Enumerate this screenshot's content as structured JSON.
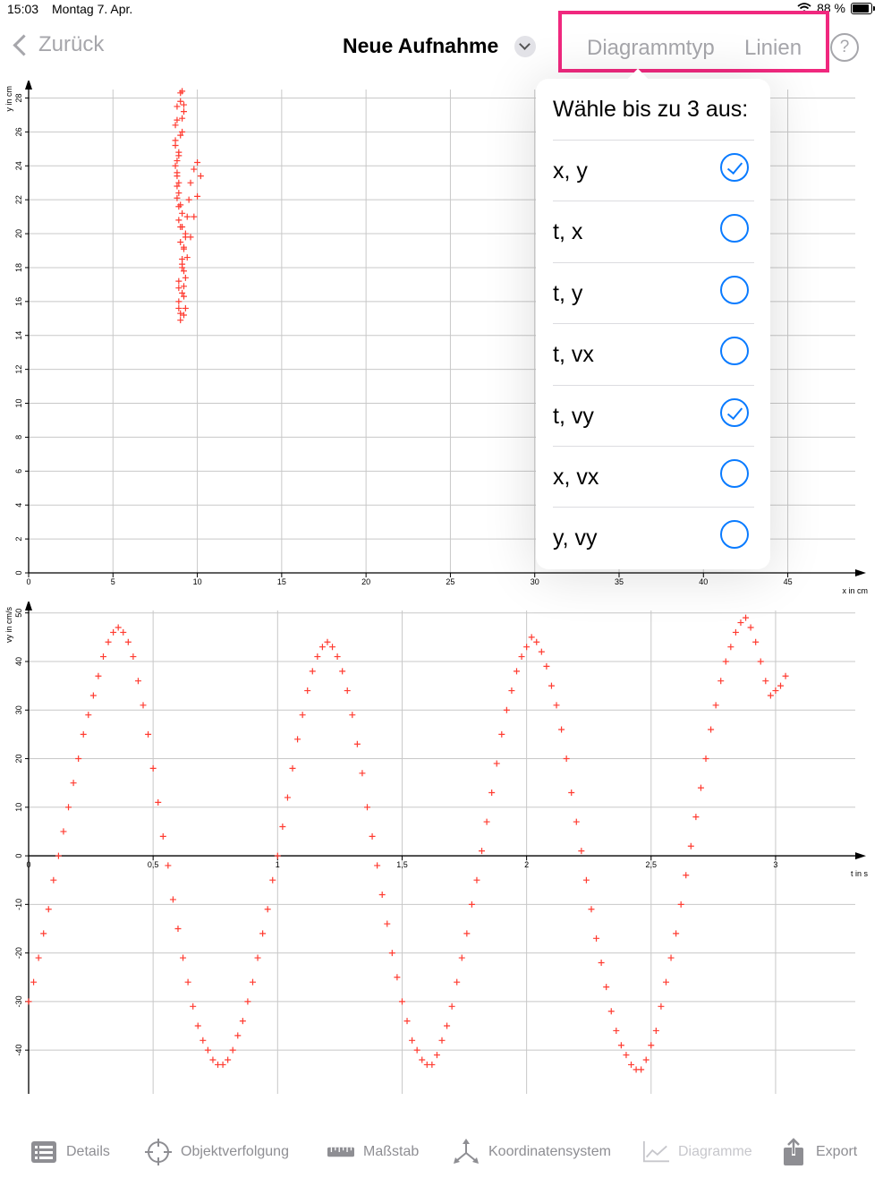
{
  "status": {
    "time": "15:03",
    "date": "Montag 7. Apr.",
    "battery": "88 %"
  },
  "nav": {
    "back": "Zurück",
    "title": "Neue Aufnahme",
    "btn_type": "Diagrammtyp",
    "btn_lines": "Linien",
    "help": "?"
  },
  "popover": {
    "heading": "Wähle bis zu 3 aus:",
    "items": [
      {
        "label": "x, y",
        "checked": true
      },
      {
        "label": "t, x",
        "checked": false
      },
      {
        "label": "t, y",
        "checked": false
      },
      {
        "label": "t, vx",
        "checked": false
      },
      {
        "label": "t, vy",
        "checked": true
      },
      {
        "label": "x, vx",
        "checked": false
      },
      {
        "label": "y, vy",
        "checked": false
      }
    ]
  },
  "chart_data": [
    {
      "type": "scatter",
      "xlabel": "x in cm",
      "ylabel": "y in cm",
      "xlim": [
        0,
        49
      ],
      "ylim": [
        0,
        28.5
      ],
      "xticks": [
        0,
        5,
        10,
        15,
        20,
        25,
        30,
        35,
        40,
        45
      ],
      "yticks": [
        0,
        2,
        4,
        6,
        8,
        10,
        12,
        14,
        16,
        18,
        20,
        22,
        24,
        26,
        28
      ],
      "grid": true,
      "marker": "+",
      "color": "#ff3b30",
      "series": [
        {
          "x": [
            9.0,
            8.9,
            8.9,
            9.1,
            9.3,
            9.4,
            9.5,
            9.6,
            9.8,
            10.0,
            10.2,
            10.0,
            9.8,
            9.6,
            9.4,
            9.3,
            9.2,
            9.2,
            9.3,
            9.2,
            9.1,
            9.0,
            8.9,
            8.8,
            8.8,
            8.9,
            9.0,
            9.1,
            9.2,
            9.0,
            8.8,
            8.7,
            8.7,
            8.7,
            8.8,
            8.9,
            9.0,
            9.2,
            9.1,
            8.9,
            8.9,
            9.0,
            9.1,
            9.2,
            9.2,
            9.1,
            9.0,
            8.9,
            8.8,
            8.7,
            8.8,
            9.0,
            9.1,
            9.2,
            9.1,
            8.9,
            8.8,
            8.9,
            9.1,
            9.3
          ],
          "y": [
            14.9,
            16.0,
            17.2,
            18.5,
            19.8,
            21.0,
            22.0,
            23.0,
            23.8,
            24.2,
            23.4,
            22.2,
            21.0,
            19.8,
            18.6,
            17.4,
            16.3,
            15.2,
            15.6,
            16.9,
            18.2,
            19.5,
            20.8,
            22.1,
            23.4,
            24.6,
            25.8,
            26.8,
            27.6,
            28.3,
            27.5,
            26.4,
            25.2,
            24.0,
            22.8,
            21.6,
            20.4,
            19.2,
            18.0,
            16.8,
            15.6,
            15.3,
            16.5,
            17.8,
            19.1,
            20.4,
            21.7,
            23.0,
            24.3,
            25.5,
            26.7,
            27.8,
            28.4,
            27.2,
            26.0,
            24.8,
            23.6,
            22.4,
            21.2,
            20.0
          ]
        }
      ]
    },
    {
      "type": "scatter",
      "xlabel": "t in s",
      "ylabel": "vy in cm/s",
      "xlim": [
        0,
        3.32
      ],
      "ylim": [
        -49,
        50.5
      ],
      "xticks": [
        0,
        0.5,
        1,
        1.5,
        2,
        2.5,
        3
      ],
      "xticklabels": [
        "0",
        "0,5",
        "1",
        "1,5",
        "2",
        "2,5",
        "3"
      ],
      "yticks": [
        -40,
        -30,
        -20,
        -10,
        0,
        10,
        20,
        30,
        40,
        50
      ],
      "grid": true,
      "marker": "+",
      "color": "#ff3b30",
      "series": [
        {
          "t": [
            0.0,
            0.02,
            0.04,
            0.06,
            0.08,
            0.1,
            0.12,
            0.14,
            0.16,
            0.18,
            0.2,
            0.22,
            0.24,
            0.26,
            0.28,
            0.3,
            0.32,
            0.34,
            0.36,
            0.38,
            0.4,
            0.42,
            0.44,
            0.46,
            0.48,
            0.5,
            0.52,
            0.54,
            0.56,
            0.58,
            0.6,
            0.62,
            0.64,
            0.66,
            0.68,
            0.7,
            0.72,
            0.74,
            0.76,
            0.78,
            0.8,
            0.82,
            0.84,
            0.86,
            0.88,
            0.9,
            0.92,
            0.94,
            0.96,
            0.98,
            1.0,
            1.02,
            1.04,
            1.06,
            1.08,
            1.1,
            1.12,
            1.14,
            1.16,
            1.18,
            1.2,
            1.22,
            1.24,
            1.26,
            1.28,
            1.3,
            1.32,
            1.34,
            1.36,
            1.38,
            1.4,
            1.42,
            1.44,
            1.46,
            1.48,
            1.5,
            1.52,
            1.54,
            1.56,
            1.58,
            1.6,
            1.62,
            1.64,
            1.66,
            1.68,
            1.7,
            1.72,
            1.74,
            1.76,
            1.78,
            1.8,
            1.82,
            1.84,
            1.86,
            1.88,
            1.9,
            1.92,
            1.94,
            1.96,
            1.98,
            2.0,
            2.02,
            2.04,
            2.06,
            2.08,
            2.1,
            2.12,
            2.14,
            2.16,
            2.18,
            2.2,
            2.22,
            2.24,
            2.26,
            2.28,
            2.3,
            2.32,
            2.34,
            2.36,
            2.38,
            2.4,
            2.42,
            2.44,
            2.46,
            2.48,
            2.5,
            2.52,
            2.54,
            2.56,
            2.58,
            2.6,
            2.62,
            2.64,
            2.66,
            2.68,
            2.7,
            2.72,
            2.74,
            2.76,
            2.78,
            2.8,
            2.82,
            2.84,
            2.86,
            2.88,
            2.9,
            2.92,
            2.94,
            2.96,
            2.98,
            3.0,
            3.02,
            3.04,
            3.06,
            3.08,
            3.1,
            3.12,
            3.14,
            3.16,
            3.18,
            3.2,
            3.22,
            3.24,
            3.26,
            3.28,
            3.3
          ],
          "vy": [
            -30,
            -26,
            -21,
            -16,
            -11,
            -5,
            0,
            5,
            10,
            15,
            20,
            25,
            29,
            33,
            37,
            41,
            44,
            46,
            47,
            46,
            44,
            41,
            36,
            31,
            25,
            18,
            11,
            4,
            -2,
            -9,
            -15,
            -21,
            -26,
            -31,
            -35,
            -38,
            -40,
            -42,
            -43,
            -43,
            -42,
            -40,
            -37,
            -34,
            -30,
            -26,
            -21,
            -16,
            -11,
            -5,
            0,
            6,
            12,
            18,
            24,
            29,
            34,
            38,
            41,
            43,
            44,
            43,
            41,
            38,
            34,
            29,
            23,
            17,
            10,
            4,
            -2,
            -8,
            -14,
            -20,
            -25,
            -30,
            -34,
            -38,
            -40,
            -42,
            -43,
            -43,
            -41,
            -38,
            -35,
            -31,
            -26,
            -21,
            -16,
            -10,
            -5,
            1,
            7,
            13,
            19,
            25,
            30,
            34,
            38,
            41,
            43,
            45,
            44,
            42,
            39,
            35,
            31,
            26,
            20,
            13,
            7,
            1,
            -5,
            -11,
            -17,
            -22,
            -27,
            -32,
            -36,
            -39,
            -41,
            -43,
            -44,
            -44,
            -42,
            -39,
            -36,
            -31,
            -26,
            -21,
            -16,
            -10,
            -4,
            2,
            8,
            14,
            20,
            26,
            31,
            36,
            40,
            43,
            46,
            48,
            49,
            47,
            44,
            40,
            36,
            33,
            34,
            35,
            37
          ]
        }
      ]
    }
  ],
  "tabs": [
    {
      "label": "Details",
      "icon": "list-icon",
      "selected": false
    },
    {
      "label": "Objektverfolgung",
      "icon": "crosshair-icon",
      "selected": false
    },
    {
      "label": "Maßstab",
      "icon": "ruler-icon",
      "selected": false
    },
    {
      "label": "Koordinatensystem",
      "icon": "axes-icon",
      "selected": false
    },
    {
      "label": "Diagramme",
      "icon": "chart-icon",
      "selected": true
    },
    {
      "label": "Export",
      "icon": "share-icon",
      "selected": false
    }
  ]
}
